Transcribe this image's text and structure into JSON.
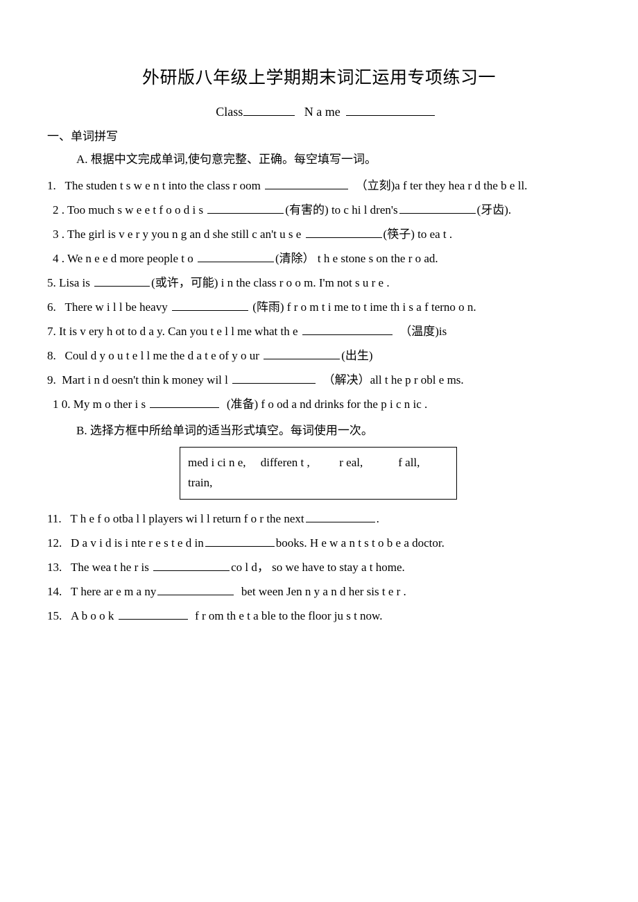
{
  "document": {
    "title": "外研版八年级上学期期末词汇运用专项练习一",
    "header_fields": {
      "class_label": "Class",
      "name_label": "N a me"
    },
    "section_one": {
      "heading": "一、单词拼写",
      "part_a_instruction": "A. 根据中文完成单词,使句意完整、正确。每空填写一词。",
      "part_b_instruction": "B. 选择方框中所给单词的适当形式填空。每词使用一次。"
    },
    "word_bank": {
      "line1": "med i ci n e,     differen t ,          r eal,            f all,",
      "line2": "train,",
      "words": [
        "medicine",
        "different",
        "real",
        "fall",
        "train"
      ]
    },
    "questions_a": [
      {
        "number": "1.",
        "pre": "The   studen t s w e n t   into   the class r oom",
        "blank": "w120",
        "post": "（立刻)a f ter they hea r d the   b e ll."
      },
      {
        "number": "2 .",
        "pre": "Too much   s w e e t   f o o d  i s",
        "blank": "w110",
        "post": "(有害的) to  c hi l dren's",
        "blank2": "w110",
        "post2": "(牙齿)."
      },
      {
        "number": "3 .",
        "pre": "The   girl is  v e r y    you n g   an d  she still   c an't u s e",
        "blank": "w110",
        "post": "(筷子) to ea t ."
      },
      {
        "number": "4 .",
        "pre": "We  n e e d   more   people  t o",
        "blank": "w110",
        "post": "(清除）  t h e stone s   on the r o ad."
      },
      {
        "number": "5.",
        "pre": "Lisa is",
        "blank": "w80",
        "post": "(或许，可能)    i n the   class r o o m. I'm not   s u r e ."
      },
      {
        "number": "6.",
        "pre": "There   w i l l  be heavy",
        "blank": "w110",
        "post": "(阵雨)   f r o m t i me  to  t ime th i s  a f terno o n."
      },
      {
        "number": "7.",
        "pre": "It is    v ery  h ot to d a y. Can you   t e l l   me what th e",
        "blank": "w130",
        "post": "（温度)is"
      },
      {
        "number": "8.",
        "pre": "Coul d  y o u   t e l l   me   the d a t e  of  y o ur",
        "blank": "w110",
        "post": "(出生)"
      },
      {
        "number": "9.",
        "pre": "Mart i  n    d oesn't   thin k   money wil l",
        "blank": "w120",
        "post": "（解决）all   t he   p r obl e ms."
      },
      {
        "number": "1 0.",
        "pre": "My  m o ther    i s",
        "blank": "w100",
        "post": "(准备) f o od  a nd drinks   for the p i c n ic ."
      }
    ],
    "questions_b": [
      {
        "number": "11.",
        "pre": "T h e f o otba l l players   wi l l   return f o r the next",
        "blank": "w100",
        "post": "."
      },
      {
        "number": "12.",
        "pre": "D a v i d is  i nte r e s t e d in",
        "blank": "w100",
        "post": "books.  H e   w a n t s   t o b e   a doctor."
      },
      {
        "number": "13.",
        "pre": "The wea t he r  is",
        "blank": "w110",
        "post": "co l d，    so we   have   to   stay a t  home."
      },
      {
        "number": "14.",
        "pre": "T here ar e   m a ny",
        "blank": "w110",
        "post": "bet ween   Jen n y  a n d her sis t e r ."
      },
      {
        "number": "15.",
        "pre": "A  b o o k",
        "blank": "w100",
        "post": "f r om th e   t a ble to the floor ju s t   now."
      }
    ]
  }
}
